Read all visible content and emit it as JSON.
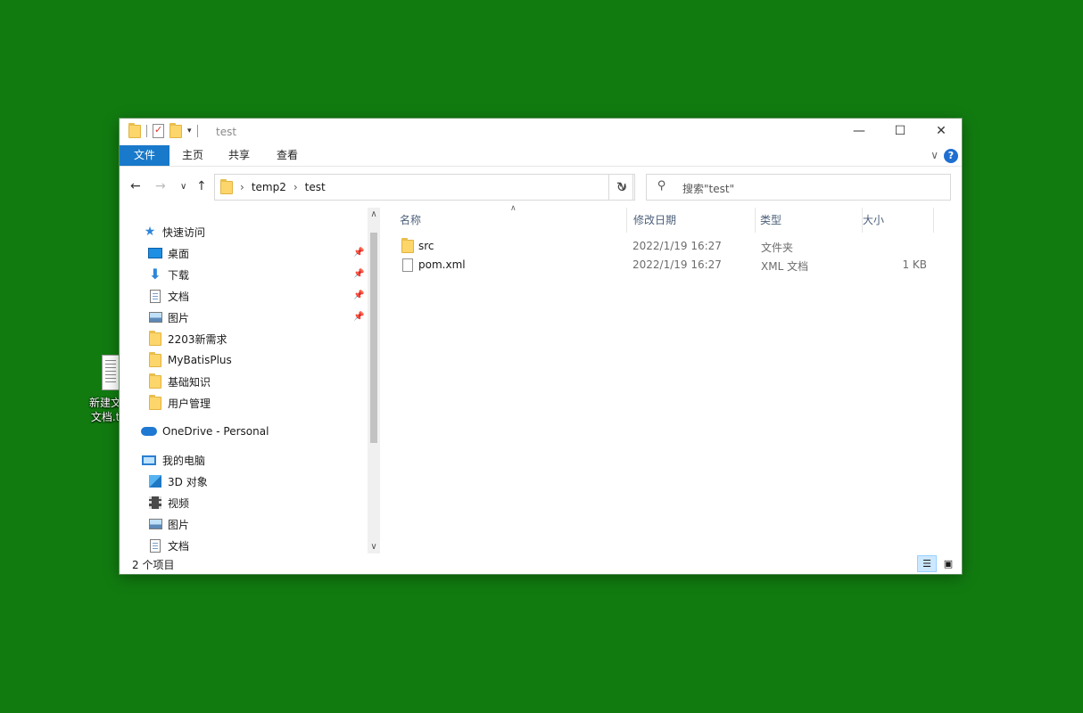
{
  "desktop": {
    "icon_label": "新建文本文档.txt"
  },
  "window": {
    "title": "test",
    "controls": {
      "minimize": "—",
      "maximize": "☐",
      "close": "✕"
    }
  },
  "ribbon": {
    "tabs": [
      {
        "label": "文件"
      },
      {
        "label": "主页"
      },
      {
        "label": "共享"
      },
      {
        "label": "查看"
      }
    ],
    "help": "?"
  },
  "nav": {
    "breadcrumb": [
      "temp2",
      "test"
    ],
    "search_placeholder": "搜索\"test\""
  },
  "sidebar": {
    "quick_access": "快速访问",
    "quick_items": [
      {
        "label": "桌面",
        "pinned": true,
        "icon": "desktop-icon"
      },
      {
        "label": "下载",
        "pinned": true,
        "icon": "download-icon"
      },
      {
        "label": "文档",
        "pinned": true,
        "icon": "document-icon"
      },
      {
        "label": "图片",
        "pinned": true,
        "icon": "picture-icon"
      },
      {
        "label": "2203新需求",
        "pinned": false,
        "icon": "folder-icon"
      },
      {
        "label": "MyBatisPlus",
        "pinned": false,
        "icon": "folder-icon"
      },
      {
        "label": "基础知识",
        "pinned": false,
        "icon": "folder-icon"
      },
      {
        "label": "用户管理",
        "pinned": false,
        "icon": "folder-icon"
      }
    ],
    "onedrive": "OneDrive - Personal",
    "this_pc": "我的电脑",
    "pc_items": [
      {
        "label": "3D 对象",
        "icon": "3d-objects-icon"
      },
      {
        "label": "视频",
        "icon": "video-icon"
      },
      {
        "label": "图片",
        "icon": "picture-icon"
      },
      {
        "label": "文档",
        "icon": "document-icon"
      }
    ]
  },
  "columns": {
    "name": "名称",
    "modified": "修改日期",
    "type": "类型",
    "size": "大小"
  },
  "files": [
    {
      "name": "src",
      "modified": "2022/1/19 16:27",
      "type": "文件夹",
      "size": "",
      "icon": "folder-icon"
    },
    {
      "name": "pom.xml",
      "modified": "2022/1/19 16:27",
      "type": "XML 文档",
      "size": "1 KB",
      "icon": "file-icon"
    }
  ],
  "status": {
    "item_count": "2 个项目"
  }
}
